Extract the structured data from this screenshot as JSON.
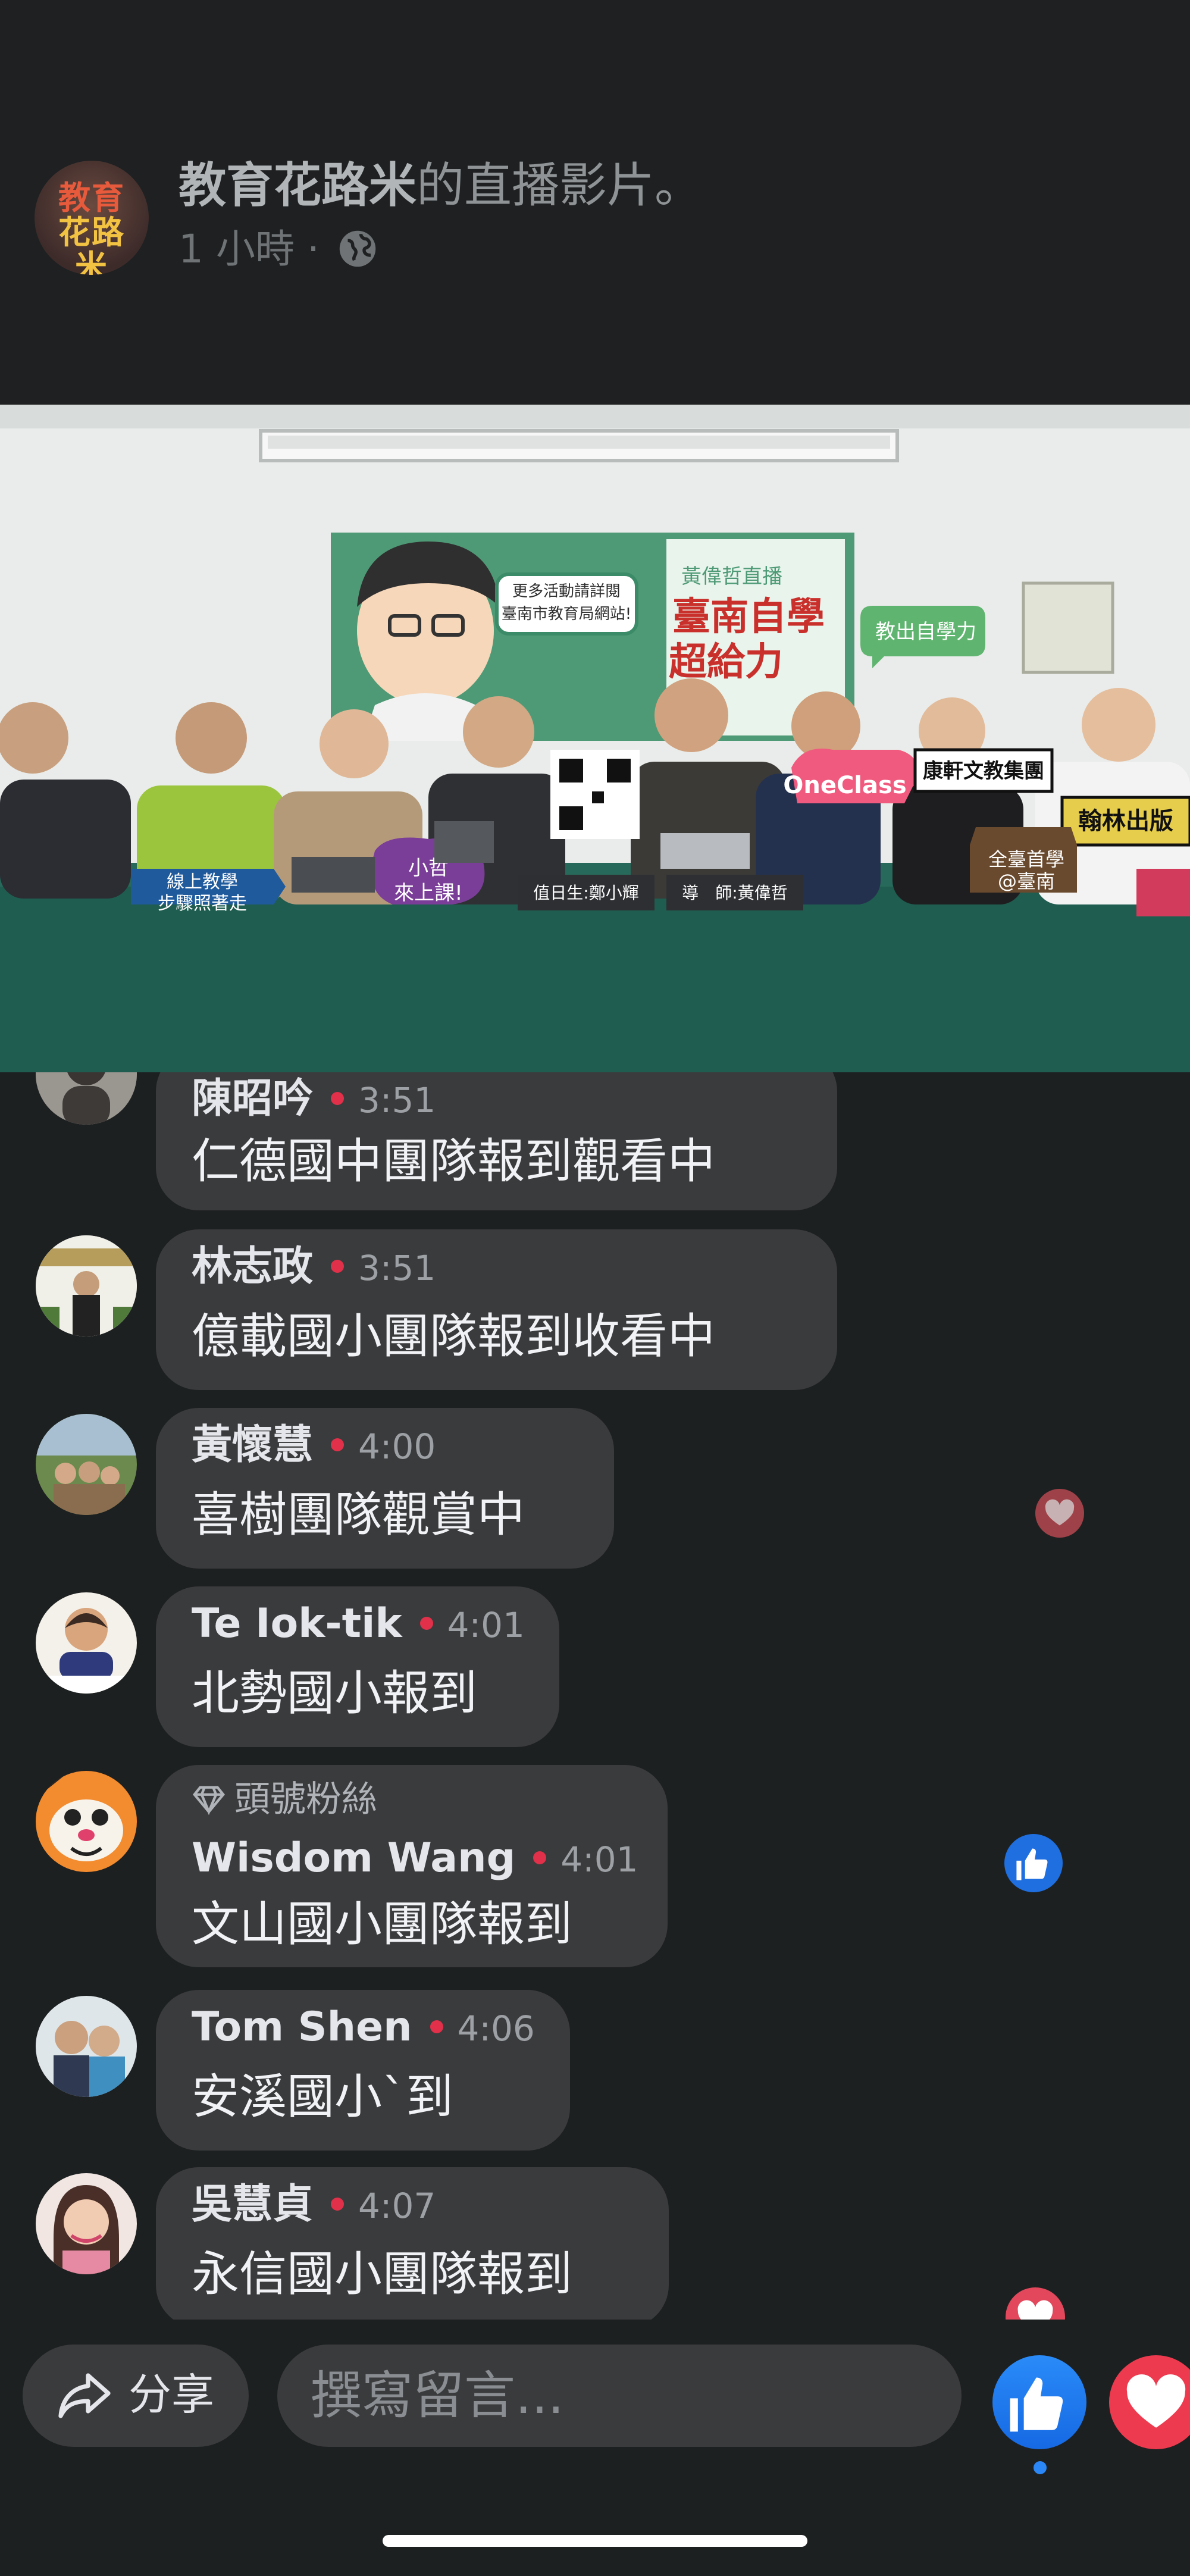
{
  "header": {
    "page_name": "教育花路米",
    "title_suffix": "的直播影片。",
    "time_ago": "1 小時 ·",
    "logo_line1": "教育",
    "logo_line2": "花路米"
  },
  "video": {
    "banner_small": "黃偉哲直播",
    "banner_main_1": "臺南自學",
    "banner_main_2": "超給力",
    "banner_bubble": "更多活動請詳閱 臺南市教育局網站!",
    "sign_right": "教出自學力",
    "sign_kang": "康軒文教集團",
    "sign_hanlin": "翰林出版",
    "sign_oneclass": "OneClass",
    "sign_online": "線上教學 步驟照著走",
    "sign_xiaozhe": "小哲 來上課!",
    "sign_duty": "值日生:鄭小輝",
    "sign_teacher": "導　師:黃偉哲",
    "sign_tainan": "全臺首學 @臺南"
  },
  "comments": [
    {
      "name": "陳昭吟",
      "time": "3:51",
      "text": "仁德國中團隊報到觀看中"
    },
    {
      "name": "林志政",
      "time": "3:51",
      "text": "億載國小團隊報到收看中"
    },
    {
      "name": "黃懷慧",
      "time": "4:00",
      "text": "喜樹團隊觀賞中"
    },
    {
      "name": "Te Iok-tik",
      "time": "4:01",
      "text": "北勢國小報到"
    },
    {
      "name": "Wisdom Wang",
      "time": "4:01",
      "text": "文山國小團隊報到",
      "badge": "頭號粉絲"
    },
    {
      "name": "Tom Shen",
      "time": "4:06",
      "text": "安溪國小`到"
    },
    {
      "name": "吳慧貞",
      "time": "4:07",
      "text": "永信國小團隊報到"
    }
  ],
  "bottom_bar": {
    "share_label": "分享",
    "comment_placeholder": "撰寫留言..."
  },
  "colors": {
    "background": "#1d2021",
    "bubble": "#3a3b3c",
    "like_blue": "#1877f2",
    "love_red": "#ee3a4e",
    "live_dot": "#e0304a"
  },
  "icons": [
    "globe-icon",
    "share-icon",
    "like-icon",
    "love-icon",
    "diamond-icon"
  ]
}
